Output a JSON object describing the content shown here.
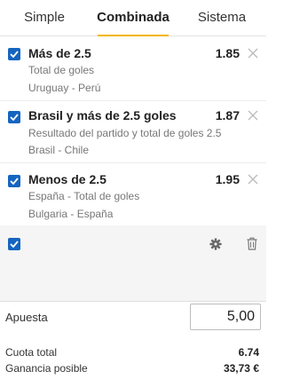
{
  "tabs": [
    {
      "label": "Simple"
    },
    {
      "label": "Combinada"
    },
    {
      "label": "Sistema"
    }
  ],
  "active_tab": "Combinada",
  "bets": [
    {
      "selection": "Más de 2.5",
      "odds": "1.85",
      "market": "Total de goles",
      "event": "Uruguay - Perú",
      "checked": true
    },
    {
      "selection": "Brasil y más de 2.5 goles",
      "odds": "1.87",
      "market": "Resultado del partido y total de goles 2.5",
      "event": "Brasil - Chile",
      "checked": true
    },
    {
      "selection": "Menos de 2.5",
      "odds": "1.95",
      "market": "España - Total de goles",
      "event": "Bulgaria - España",
      "checked": true
    }
  ],
  "select_all_checked": true,
  "stake": {
    "label": "Apuesta",
    "value": "5,00"
  },
  "summary": {
    "total_odds_label": "Cuota total",
    "total_odds_value": "6.74",
    "potential_win_label": "Ganancia posible",
    "potential_win_value": "33,73 €"
  },
  "colors": {
    "accent": "#f2b600",
    "checkbox": "#1565c0"
  }
}
